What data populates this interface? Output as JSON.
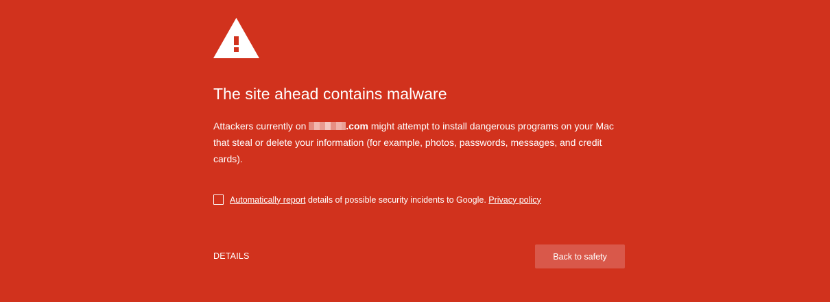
{
  "colors": {
    "background": "#d1321d",
    "button_bg": "#d9584a",
    "text": "#ffffff"
  },
  "icon": "warning-triangle-icon",
  "heading": "The site ahead contains malware",
  "message": {
    "prefix": "Attackers currently on ",
    "domain_suffix": ".com",
    "suffix": " might attempt to install dangerous programs on your Mac that steal or delete your information (for example, photos, passwords, messages, and credit cards)."
  },
  "report": {
    "checked": false,
    "link_label": "Automatically report",
    "text": " details of possible security incidents to Google. ",
    "privacy_label": "Privacy policy"
  },
  "details_label": "DETAILS",
  "back_button_label": "Back to safety"
}
